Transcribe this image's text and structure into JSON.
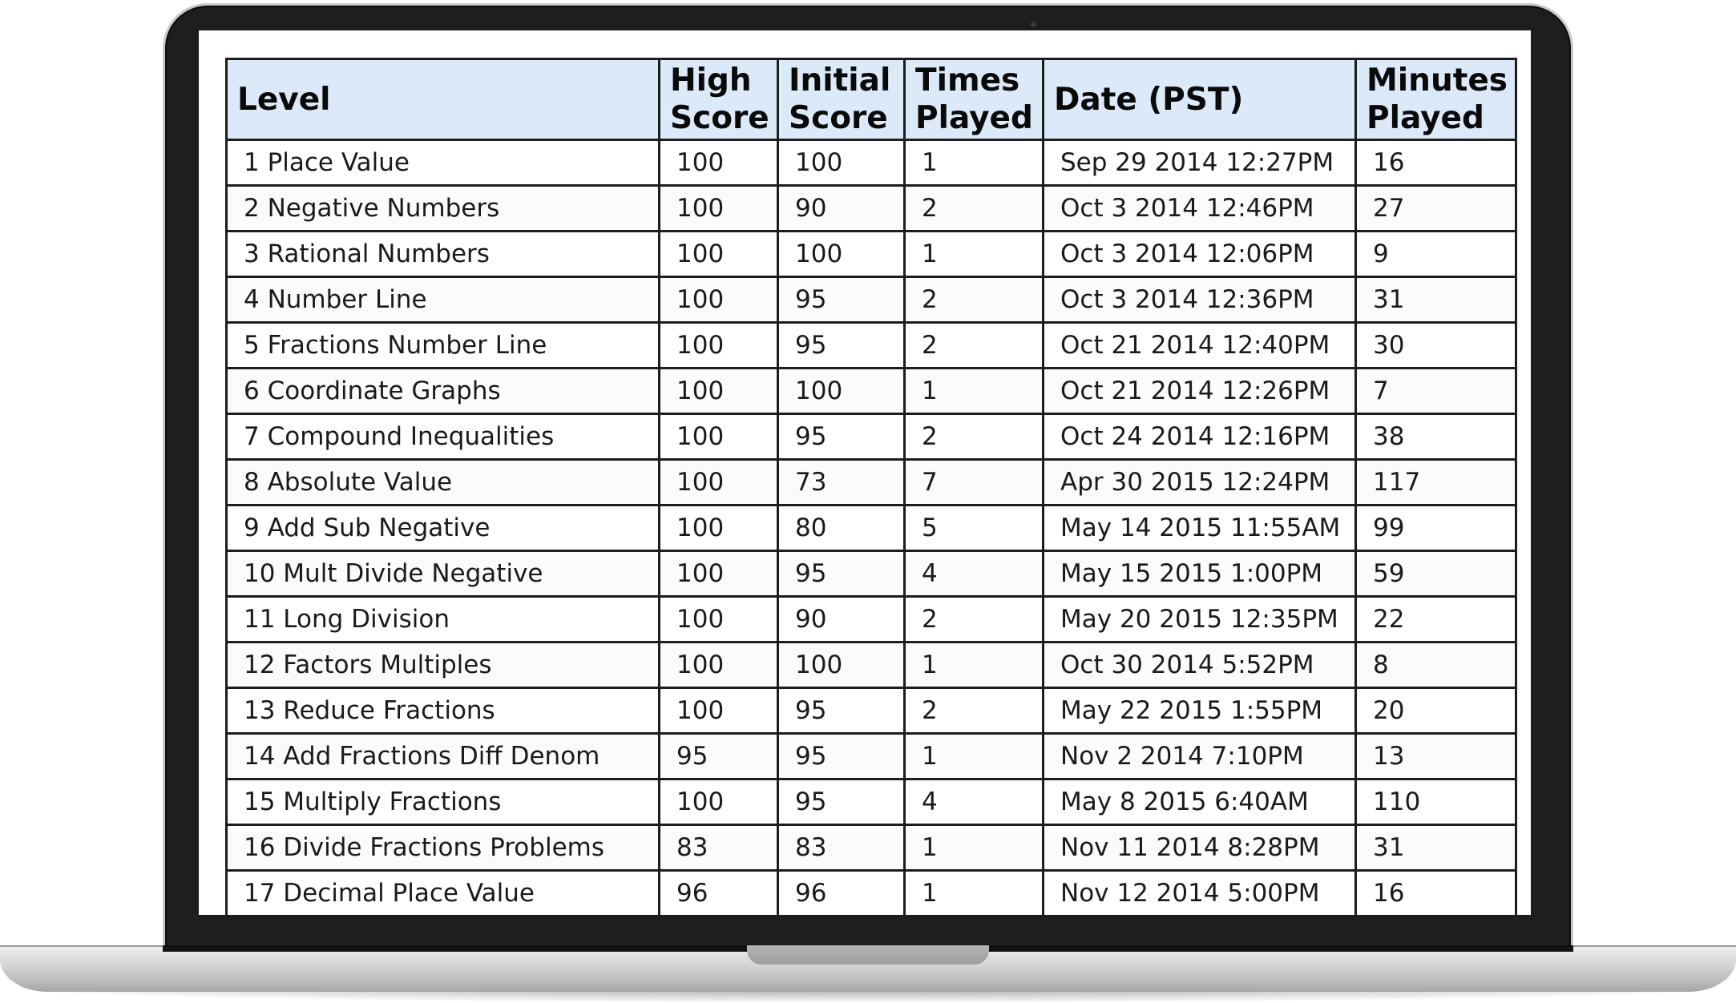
{
  "table": {
    "headers": [
      "Level",
      "High Score",
      "Initial Score",
      "Times Played",
      "Date (PST)",
      "Minutes Played"
    ],
    "rows": [
      [
        "1 Place Value",
        "100",
        "100",
        "1",
        "Sep 29 2014 12:27PM",
        "16"
      ],
      [
        "2 Negative Numbers",
        "100",
        "90",
        "2",
        "Oct 3 2014 12:46PM",
        "27"
      ],
      [
        "3 Rational Numbers",
        "100",
        "100",
        "1",
        "Oct 3 2014 12:06PM",
        "9"
      ],
      [
        "4 Number Line",
        "100",
        "95",
        "2",
        "Oct 3 2014 12:36PM",
        "31"
      ],
      [
        "5 Fractions Number Line",
        "100",
        "95",
        "2",
        "Oct 21 2014 12:40PM",
        "30"
      ],
      [
        "6 Coordinate Graphs",
        "100",
        "100",
        "1",
        "Oct 21 2014 12:26PM",
        "7"
      ],
      [
        "7 Compound Inequalities",
        "100",
        "95",
        "2",
        "Oct 24 2014 12:16PM",
        "38"
      ],
      [
        "8 Absolute Value",
        "100",
        "73",
        "7",
        "Apr 30 2015 12:24PM",
        "117"
      ],
      [
        "9 Add Sub Negative",
        "100",
        "80",
        "5",
        "May 14 2015 11:55AM",
        "99"
      ],
      [
        "10 Mult Divide Negative",
        "100",
        "95",
        "4",
        "May 15 2015 1:00PM",
        "59"
      ],
      [
        "11 Long Division",
        "100",
        "90",
        "2",
        "May 20 2015 12:35PM",
        "22"
      ],
      [
        "12 Factors Multiples",
        "100",
        "100",
        "1",
        "Oct 30 2014 5:52PM",
        "8"
      ],
      [
        "13 Reduce Fractions",
        "100",
        "95",
        "2",
        "May 22 2015 1:55PM",
        "20"
      ],
      [
        "14 Add Fractions Diff Denom",
        "95",
        "95",
        "1",
        "Nov 2 2014 7:10PM",
        "13"
      ],
      [
        "15 Multiply Fractions",
        "100",
        "95",
        "4",
        "May 8 2015 6:40AM",
        "110"
      ],
      [
        "16 Divide Fractions Problems",
        "83",
        "83",
        "1",
        "Nov 11 2014 8:28PM",
        "31"
      ],
      [
        "17 Decimal Place Value",
        "96",
        "96",
        "1",
        "Nov 12 2014 5:00PM",
        "16"
      ]
    ]
  }
}
